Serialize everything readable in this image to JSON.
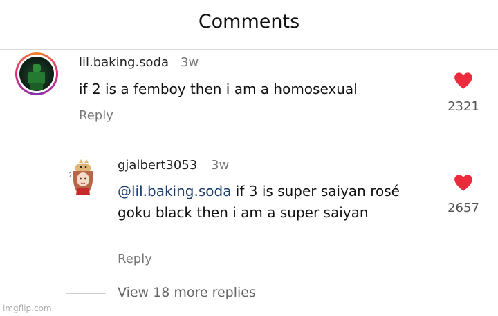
{
  "header": {
    "title": "Comments"
  },
  "comments": [
    {
      "username": "lil.baking.soda",
      "time": "3w",
      "text": "if 2 is a femboy then i am a homosexual",
      "reply_label": "Reply",
      "likes": "2321",
      "avatar_icon": "lego-figure-avatar"
    }
  ],
  "replies": [
    {
      "username": "gjalbert3053",
      "time": "3w",
      "mention": "@lil.baking.soda",
      "text_after_mention": " if 3 is super saiyan rosé goku black then i am a super saiyan",
      "reply_label": "Reply",
      "likes": "2657",
      "avatar_icon": "anime-character-avatar"
    }
  ],
  "view_more": "View 18 more replies",
  "watermark": "imgflip.com",
  "colors": {
    "heart": "#ee2a3d",
    "mention": "#1c3f70",
    "muted": "#777777"
  }
}
